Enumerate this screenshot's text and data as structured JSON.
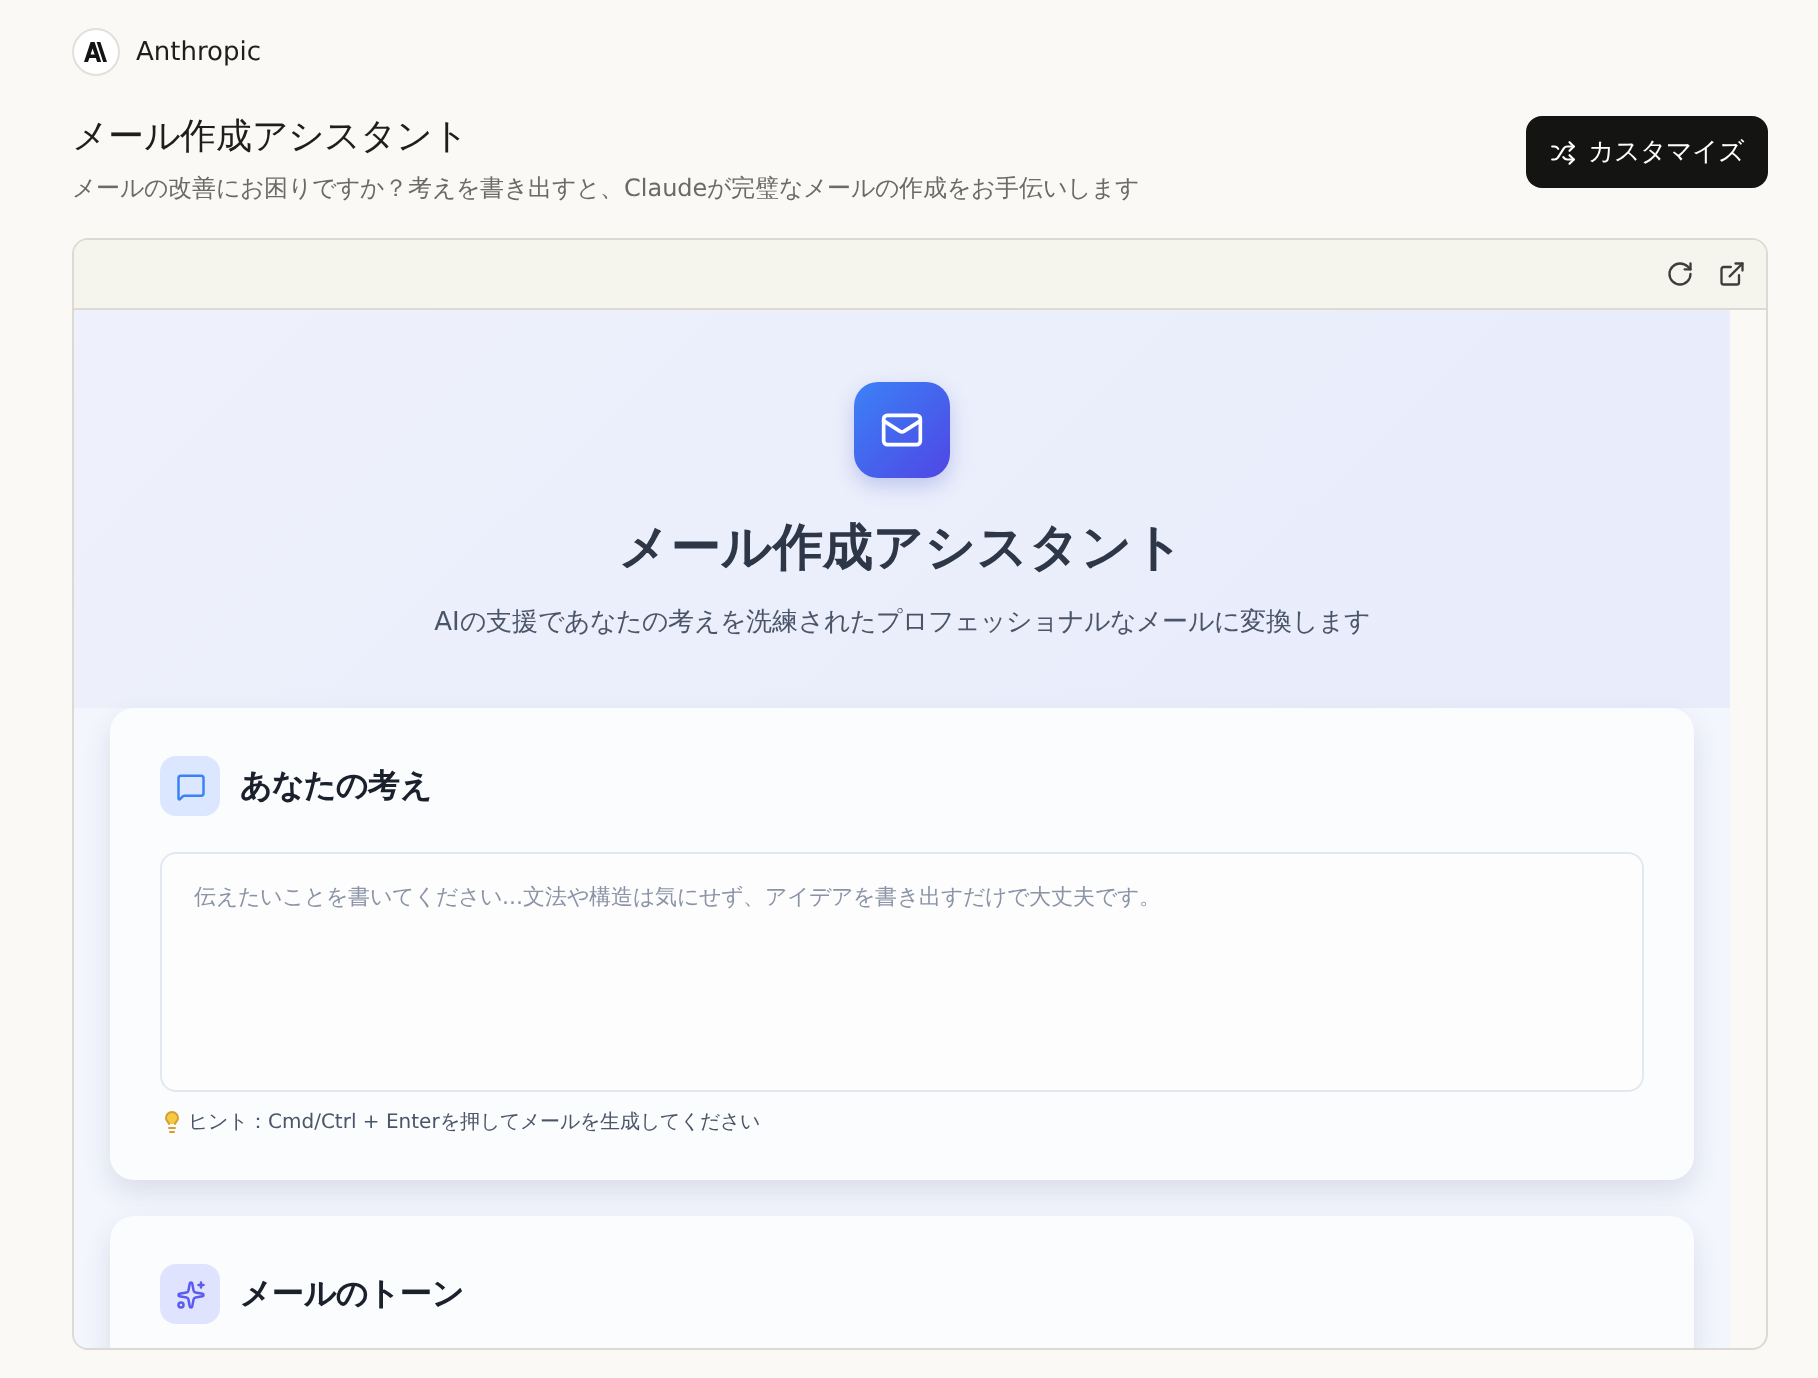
{
  "brand": "Anthropic",
  "page": {
    "title": "メール作成アシスタント",
    "subtitle": "メールの改善にお困りですか？考えを書き出すと、Claudeが完璧なメールの作成をお手伝いします",
    "button": "カスタマイズ"
  },
  "app": {
    "title": "メール作成アシスタント",
    "subtitle": "AIの支援であなたの考えを洗練されたプロフェッショナルなメールに変換します",
    "sections": [
      {
        "kind": "input",
        "title": "あなたの考え",
        "placeholder": "伝えたいことを書いてください...文法や構造は気にせず、アイデアを書き出すだけで大丈夫です。",
        "hint": "ヒント：Cmd/Ctrl + Enterを押してメールを生成してください"
      },
      {
        "kind": "tone",
        "title": "メールのトーン"
      }
    ]
  }
}
